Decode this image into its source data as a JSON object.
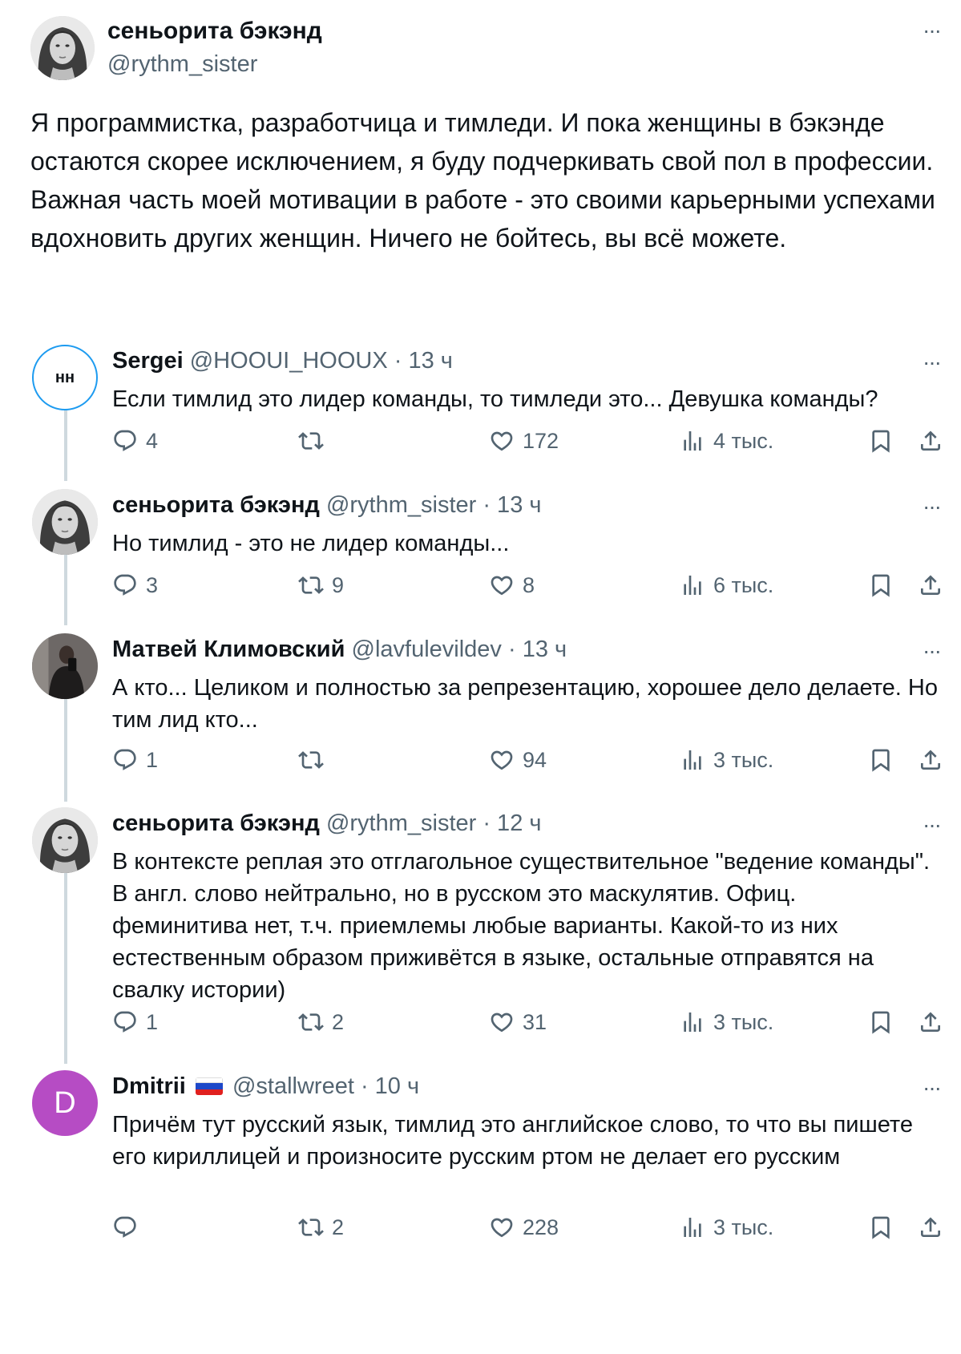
{
  "main": {
    "name": "сеньорита бэкэнд",
    "handle": "@rythm_sister",
    "more": "···",
    "text": "Я программистка, разработчица и тимледи. И пока женщины в бэкэнде остаются скорее исключением, я буду подчеркивать свой пол в профессии. Важная часть моей мотивации в работе - это своими карьерными успехами вдохновить других женщин. Ничего не бойтесь, вы всё можете."
  },
  "replies": [
    {
      "name": "Sergei",
      "meta": "@HOOUI_HOOUX · 13 ч",
      "avatar_text": "ʜʜ",
      "text": "Если тимлид это лидер команды, то тимледи это... Девушка команды?",
      "replies": "4",
      "retweets": "",
      "likes": "172",
      "views": "4 тыс."
    },
    {
      "name": "сеньорита бэкэнд",
      "meta": "@rythm_sister · 13 ч",
      "text": "Но тимлид - это не лидер команды...",
      "replies": "3",
      "retweets": "9",
      "likes": "8",
      "views": "6 тыс."
    },
    {
      "name": "Матвей Климовский",
      "meta": "@lavfulevildev · 13 ч",
      "text": "А кто... Целиком и полностью за репрезентацию, хорошее дело делаете. Но тим лид кто...",
      "replies": "1",
      "retweets": "",
      "likes": "94",
      "views": "3 тыс."
    },
    {
      "name": "сеньорита бэкэнд",
      "meta": "@rythm_sister · 12 ч",
      "text": "В контексте реплая это отглагольное существительное \"ведение команды\". В англ. слово нейтрально, но в русском это маскулятив. Офиц. феминитива нет, т.ч. приемлемы любые варианты. Какой-то из них естественным образом приживётся в языке, остальные отправятся на свалку истории)",
      "replies": "1",
      "retweets": "2",
      "likes": "31",
      "views": "3 тыс."
    },
    {
      "name": "Dmitrii",
      "meta": "@stallwreet · 10 ч",
      "avatar_text": "D",
      "text": "Причём тут русский язык,  тимлид это английское слово, то что вы пишете его кириллицей и произносите русским ртом не делает его русским",
      "replies": "",
      "retweets": "2",
      "likes": "228",
      "views": "3 тыс."
    }
  ],
  "colors": {
    "text": "#0f1419",
    "secondary": "#536471",
    "thread_line": "#cfd9de",
    "dmitrii_avatar": "#b64cc4",
    "sergei_avatar_border": "#1d9bf0"
  }
}
